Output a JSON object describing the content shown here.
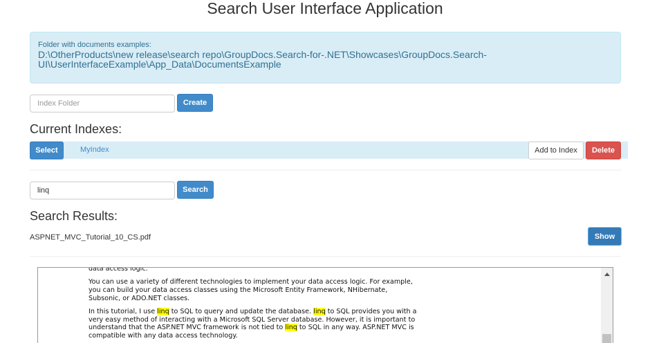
{
  "title": "Search User Interface Application",
  "alert": {
    "label": "Folder with documents examples:",
    "path_line1": "D:\\OtherProducts\\new release\\search repo\\GroupDocs.Search-for-.NET\\Showcases\\GroupDocs.Search-",
    "path_line2": "UI\\UserInterfaceExample\\App_Data\\DocumentsExample"
  },
  "index_folder": {
    "placeholder": "Index Folder",
    "create_label": "Create"
  },
  "current_indexes": {
    "heading": "Current Indexes:",
    "select_label": "Select",
    "index_name": "MyIndex",
    "add_label": "Add to Index",
    "delete_label": "Delete"
  },
  "search": {
    "value": "linq",
    "button_label": "Search"
  },
  "results": {
    "heading": "Search Results:",
    "file_name": "ASPNET_MVC_Tutorial_10_CS.pdf",
    "show_label": "Show"
  },
  "document": {
    "p0": "data access logic.",
    "p1": "You can use a variety of different technologies to implement your data access logic. For example, you can build your data access classes using the Microsoft Entity Framework, NHibernate, Subsonic, or ADO.NET classes.",
    "p2a": "In this tutorial, I use ",
    "hl": "linq",
    "p2b": " to SQL to query and update the database. ",
    "p2c": " to SQL provides you with a very easy method of interacting with a Microsoft SQL Server database. However, it is important to understand that the ASP.NET MVC framework is not tied to ",
    "p2d": " to SQL in any way. ASP.NET MVC is compatible with any data access technology."
  },
  "colors": {
    "primary": "#428bca",
    "danger": "#d9534f",
    "info_bg": "#d9edf7",
    "highlight": "#ffff00"
  }
}
